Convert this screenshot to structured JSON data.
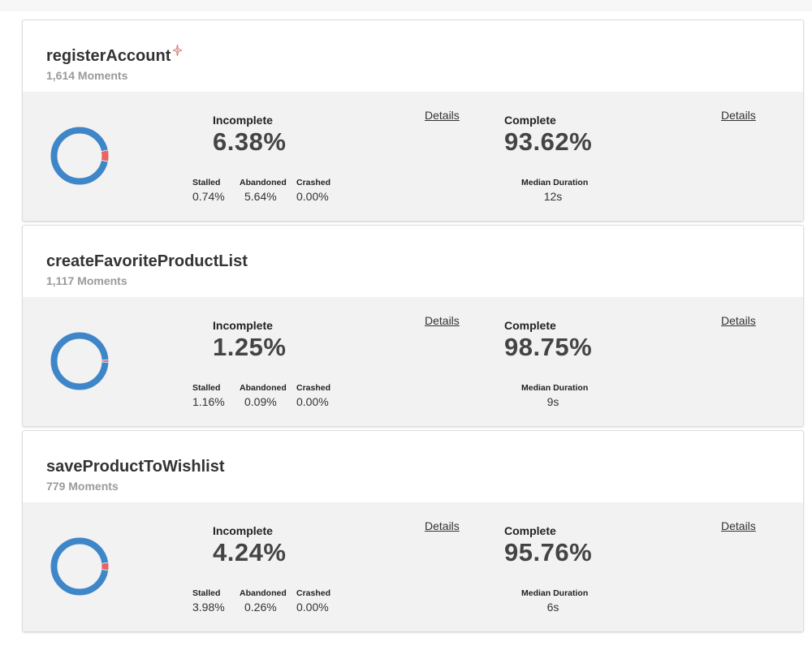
{
  "colors": {
    "complete": "#3f86c8",
    "incomplete": "#ec6162",
    "card_body": "#f2f2f2",
    "sparkle": "#e07a6a"
  },
  "labels": {
    "incomplete": "Incomplete",
    "complete": "Complete",
    "details": "Details",
    "stalled": "Stalled",
    "abandoned": "Abandoned",
    "crashed": "Crashed",
    "median_duration": "Median Duration"
  },
  "cards": [
    {
      "title": "registerAccount",
      "has_sparkle": true,
      "moments": "1,614 Moments",
      "incomplete_pct": "6.38%",
      "complete_pct": "93.62%",
      "incomplete_fraction": 0.0638,
      "stalled": "0.74%",
      "abandoned": "5.64%",
      "crashed": "0.00%",
      "median_duration": "12s"
    },
    {
      "title": "createFavoriteProductList",
      "has_sparkle": false,
      "moments": "1,117 Moments",
      "incomplete_pct": "1.25%",
      "complete_pct": "98.75%",
      "incomplete_fraction": 0.0125,
      "stalled": "1.16%",
      "abandoned": "0.09%",
      "crashed": "0.00%",
      "median_duration": "9s"
    },
    {
      "title": "saveProductToWishlist",
      "has_sparkle": false,
      "moments": "779 Moments",
      "incomplete_pct": "4.24%",
      "complete_pct": "95.76%",
      "incomplete_fraction": 0.0424,
      "stalled": "3.98%",
      "abandoned": "0.26%",
      "crashed": "0.00%",
      "median_duration": "6s"
    }
  ]
}
